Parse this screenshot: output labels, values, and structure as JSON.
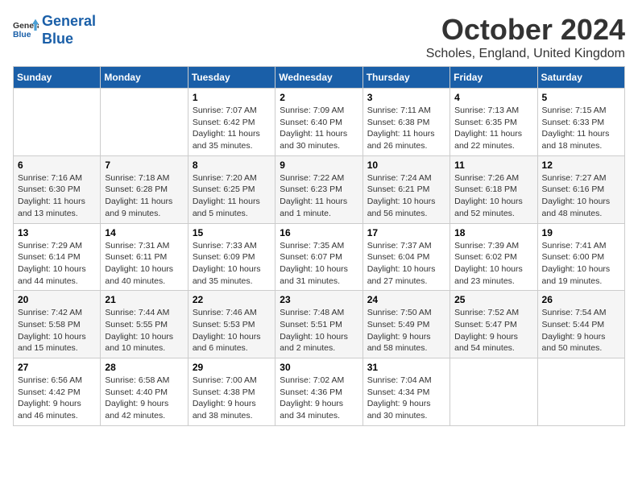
{
  "header": {
    "logo_line1": "General",
    "logo_line2": "Blue",
    "month_title": "October 2024",
    "location": "Scholes, England, United Kingdom"
  },
  "weekdays": [
    "Sunday",
    "Monday",
    "Tuesday",
    "Wednesday",
    "Thursday",
    "Friday",
    "Saturday"
  ],
  "weeks": [
    [
      {
        "day": "",
        "sunrise": "",
        "sunset": "",
        "daylight": ""
      },
      {
        "day": "",
        "sunrise": "",
        "sunset": "",
        "daylight": ""
      },
      {
        "day": "1",
        "sunrise": "Sunrise: 7:07 AM",
        "sunset": "Sunset: 6:42 PM",
        "daylight": "Daylight: 11 hours and 35 minutes."
      },
      {
        "day": "2",
        "sunrise": "Sunrise: 7:09 AM",
        "sunset": "Sunset: 6:40 PM",
        "daylight": "Daylight: 11 hours and 30 minutes."
      },
      {
        "day": "3",
        "sunrise": "Sunrise: 7:11 AM",
        "sunset": "Sunset: 6:38 PM",
        "daylight": "Daylight: 11 hours and 26 minutes."
      },
      {
        "day": "4",
        "sunrise": "Sunrise: 7:13 AM",
        "sunset": "Sunset: 6:35 PM",
        "daylight": "Daylight: 11 hours and 22 minutes."
      },
      {
        "day": "5",
        "sunrise": "Sunrise: 7:15 AM",
        "sunset": "Sunset: 6:33 PM",
        "daylight": "Daylight: 11 hours and 18 minutes."
      }
    ],
    [
      {
        "day": "6",
        "sunrise": "Sunrise: 7:16 AM",
        "sunset": "Sunset: 6:30 PM",
        "daylight": "Daylight: 11 hours and 13 minutes."
      },
      {
        "day": "7",
        "sunrise": "Sunrise: 7:18 AM",
        "sunset": "Sunset: 6:28 PM",
        "daylight": "Daylight: 11 hours and 9 minutes."
      },
      {
        "day": "8",
        "sunrise": "Sunrise: 7:20 AM",
        "sunset": "Sunset: 6:25 PM",
        "daylight": "Daylight: 11 hours and 5 minutes."
      },
      {
        "day": "9",
        "sunrise": "Sunrise: 7:22 AM",
        "sunset": "Sunset: 6:23 PM",
        "daylight": "Daylight: 11 hours and 1 minute."
      },
      {
        "day": "10",
        "sunrise": "Sunrise: 7:24 AM",
        "sunset": "Sunset: 6:21 PM",
        "daylight": "Daylight: 10 hours and 56 minutes."
      },
      {
        "day": "11",
        "sunrise": "Sunrise: 7:26 AM",
        "sunset": "Sunset: 6:18 PM",
        "daylight": "Daylight: 10 hours and 52 minutes."
      },
      {
        "day": "12",
        "sunrise": "Sunrise: 7:27 AM",
        "sunset": "Sunset: 6:16 PM",
        "daylight": "Daylight: 10 hours and 48 minutes."
      }
    ],
    [
      {
        "day": "13",
        "sunrise": "Sunrise: 7:29 AM",
        "sunset": "Sunset: 6:14 PM",
        "daylight": "Daylight: 10 hours and 44 minutes."
      },
      {
        "day": "14",
        "sunrise": "Sunrise: 7:31 AM",
        "sunset": "Sunset: 6:11 PM",
        "daylight": "Daylight: 10 hours and 40 minutes."
      },
      {
        "day": "15",
        "sunrise": "Sunrise: 7:33 AM",
        "sunset": "Sunset: 6:09 PM",
        "daylight": "Daylight: 10 hours and 35 minutes."
      },
      {
        "day": "16",
        "sunrise": "Sunrise: 7:35 AM",
        "sunset": "Sunset: 6:07 PM",
        "daylight": "Daylight: 10 hours and 31 minutes."
      },
      {
        "day": "17",
        "sunrise": "Sunrise: 7:37 AM",
        "sunset": "Sunset: 6:04 PM",
        "daylight": "Daylight: 10 hours and 27 minutes."
      },
      {
        "day": "18",
        "sunrise": "Sunrise: 7:39 AM",
        "sunset": "Sunset: 6:02 PM",
        "daylight": "Daylight: 10 hours and 23 minutes."
      },
      {
        "day": "19",
        "sunrise": "Sunrise: 7:41 AM",
        "sunset": "Sunset: 6:00 PM",
        "daylight": "Daylight: 10 hours and 19 minutes."
      }
    ],
    [
      {
        "day": "20",
        "sunrise": "Sunrise: 7:42 AM",
        "sunset": "Sunset: 5:58 PM",
        "daylight": "Daylight: 10 hours and 15 minutes."
      },
      {
        "day": "21",
        "sunrise": "Sunrise: 7:44 AM",
        "sunset": "Sunset: 5:55 PM",
        "daylight": "Daylight: 10 hours and 10 minutes."
      },
      {
        "day": "22",
        "sunrise": "Sunrise: 7:46 AM",
        "sunset": "Sunset: 5:53 PM",
        "daylight": "Daylight: 10 hours and 6 minutes."
      },
      {
        "day": "23",
        "sunrise": "Sunrise: 7:48 AM",
        "sunset": "Sunset: 5:51 PM",
        "daylight": "Daylight: 10 hours and 2 minutes."
      },
      {
        "day": "24",
        "sunrise": "Sunrise: 7:50 AM",
        "sunset": "Sunset: 5:49 PM",
        "daylight": "Daylight: 9 hours and 58 minutes."
      },
      {
        "day": "25",
        "sunrise": "Sunrise: 7:52 AM",
        "sunset": "Sunset: 5:47 PM",
        "daylight": "Daylight: 9 hours and 54 minutes."
      },
      {
        "day": "26",
        "sunrise": "Sunrise: 7:54 AM",
        "sunset": "Sunset: 5:44 PM",
        "daylight": "Daylight: 9 hours and 50 minutes."
      }
    ],
    [
      {
        "day": "27",
        "sunrise": "Sunrise: 6:56 AM",
        "sunset": "Sunset: 4:42 PM",
        "daylight": "Daylight: 9 hours and 46 minutes."
      },
      {
        "day": "28",
        "sunrise": "Sunrise: 6:58 AM",
        "sunset": "Sunset: 4:40 PM",
        "daylight": "Daylight: 9 hours and 42 minutes."
      },
      {
        "day": "29",
        "sunrise": "Sunrise: 7:00 AM",
        "sunset": "Sunset: 4:38 PM",
        "daylight": "Daylight: 9 hours and 38 minutes."
      },
      {
        "day": "30",
        "sunrise": "Sunrise: 7:02 AM",
        "sunset": "Sunset: 4:36 PM",
        "daylight": "Daylight: 9 hours and 34 minutes."
      },
      {
        "day": "31",
        "sunrise": "Sunrise: 7:04 AM",
        "sunset": "Sunset: 4:34 PM",
        "daylight": "Daylight: 9 hours and 30 minutes."
      },
      {
        "day": "",
        "sunrise": "",
        "sunset": "",
        "daylight": ""
      },
      {
        "day": "",
        "sunrise": "",
        "sunset": "",
        "daylight": ""
      }
    ]
  ]
}
